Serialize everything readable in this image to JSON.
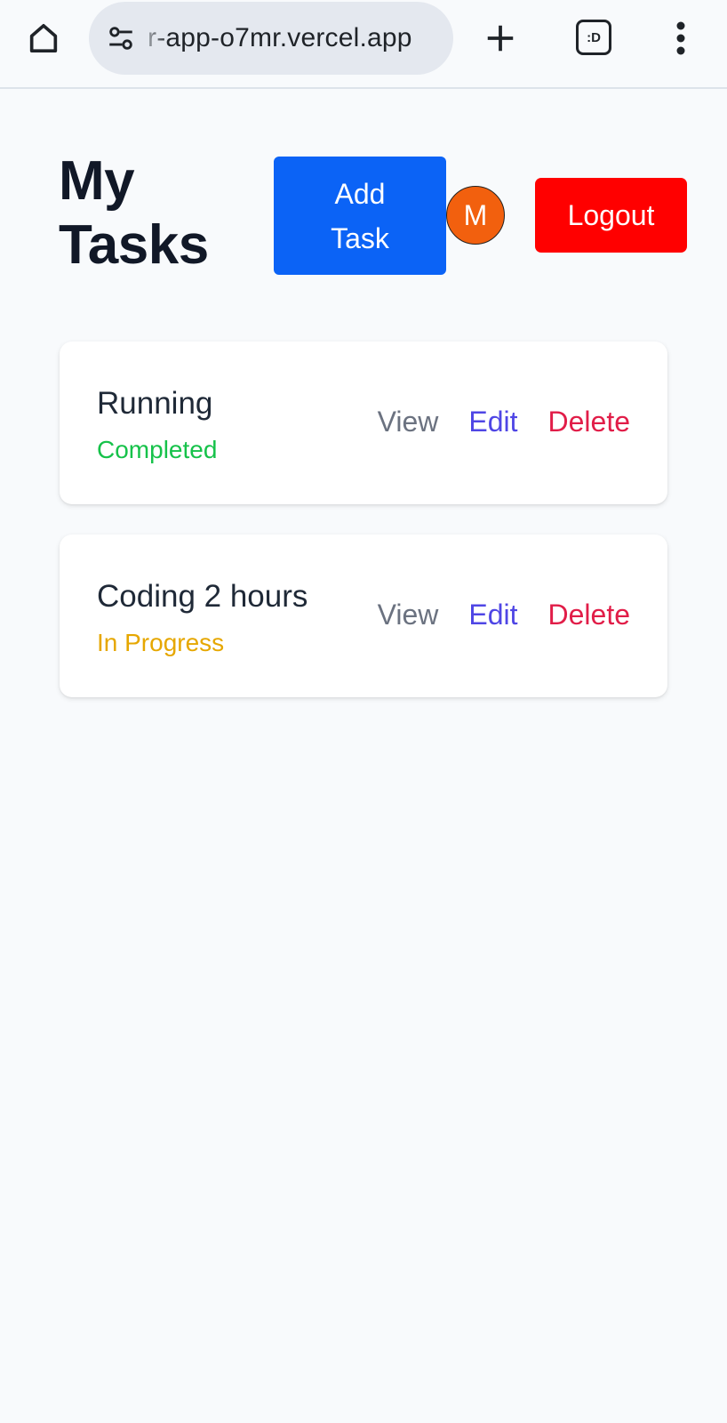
{
  "browser": {
    "url": "r-app-o7mr.vercel.app",
    "tab_switcher_label": ":D"
  },
  "header": {
    "title": "My Tasks",
    "add_task_label": "Add Task",
    "avatar_initial": "M",
    "logout_label": "Logout"
  },
  "colors": {
    "add_button": "#0b63f6",
    "avatar": "#f2600e",
    "logout_button": "#ff0000",
    "status_completed": "#16c24a",
    "status_in_progress": "#e6a700",
    "view": "#6b7280",
    "edit": "#4f46e5",
    "delete": "#e11d48"
  },
  "tasks": [
    {
      "title": "Running",
      "status": "Completed",
      "view_label": "View",
      "edit_label": "Edit",
      "delete_label": "Delete"
    },
    {
      "title": "Coding 2 hours",
      "status": "In Progress",
      "view_label": "View",
      "edit_label": "Edit",
      "delete_label": "Delete"
    }
  ]
}
